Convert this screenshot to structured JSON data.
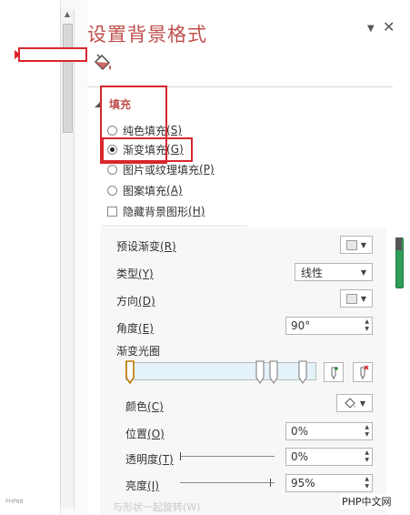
{
  "pane": {
    "title": "设置背景格式"
  },
  "fill": {
    "heading": "填充",
    "options": [
      {
        "label": "纯色填充",
        "key": "(S)",
        "checked": false
      },
      {
        "label": "渐变填充",
        "key": "(G)",
        "checked": true
      },
      {
        "label": "图片或纹理填充",
        "key": "(P)",
        "checked": false
      },
      {
        "label": "图案填充",
        "key": "(A)",
        "checked": false
      }
    ],
    "hide_bg": {
      "label": "隐藏背景图形",
      "key": "(H)",
      "checked": false
    }
  },
  "gradient": {
    "preset_label": "预设渐变",
    "preset_key": "(R)",
    "type_label": "类型",
    "type_key": "(Y)",
    "type_value": "线性",
    "direction_label": "方向",
    "direction_key": "(D)",
    "angle_label": "角度",
    "angle_key": "(E)",
    "angle_value": "90°",
    "stops_label": "渐变光圈",
    "color_label": "颜色",
    "color_key": "(C)",
    "position_label": "位置",
    "position_key": "(O)",
    "position_value": "0%",
    "transparency_label": "透明度",
    "transparency_key": "(T)",
    "transparency_value": "0%",
    "brightness_label": "亮度",
    "brightness_key": "(I)",
    "brightness_value": "95%",
    "cutoff_label": "与形状一起旋转(W)",
    "transparency_fraction": 0,
    "brightness_fraction": 0.95
  },
  "watermark": "PHP中文网",
  "tiny_text": "PHP88",
  "colors": {
    "accent": "#c0504d",
    "highlight": "#d9262c",
    "scroll": "#2f9d57"
  }
}
